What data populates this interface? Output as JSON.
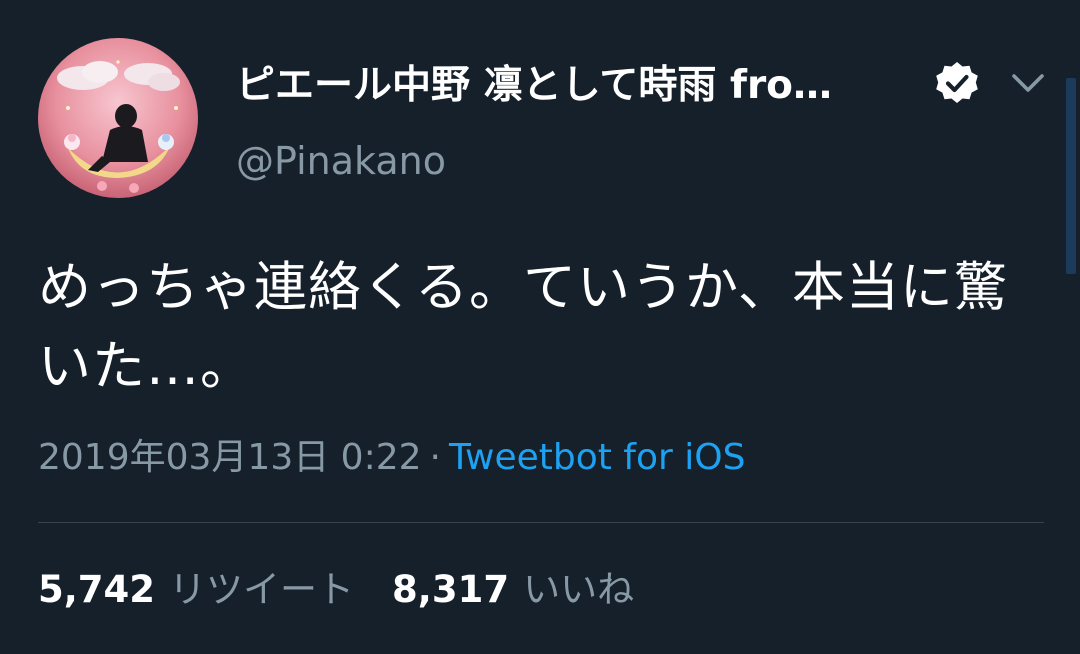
{
  "author": {
    "display_name": "ピエール中野 凛として時雨 fro…",
    "handle": "@Pinakano",
    "verified": true,
    "avatar": "avatar-image"
  },
  "tweet": {
    "text": "めっちゃ連絡くる。ていうか、本当に驚いた…。",
    "datetime": "2019年03月13日 0:22",
    "separator": "·",
    "client": "Tweetbot for iOS"
  },
  "stats": {
    "retweets_count": "5,742",
    "retweets_label": "リツイート",
    "likes_count": "8,317",
    "likes_label": "いいね"
  },
  "icons": {
    "verified": "verified-badge-icon",
    "menu": "chevron-down-icon"
  },
  "colors": {
    "background": "#15202b",
    "text": "#ffffff",
    "secondary_text": "#8899a6",
    "link": "#1da1f2",
    "divider": "#38444d"
  }
}
